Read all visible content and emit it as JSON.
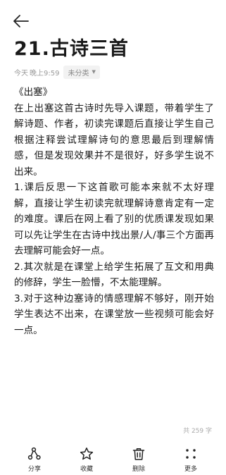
{
  "header": {
    "back_icon": "arrow-left-icon"
  },
  "note": {
    "title": "21.古诗三首",
    "date": "今天",
    "time": "晚上9:59",
    "category": "未分类",
    "category_icon": "triangle-down-icon",
    "paragraphs": [
      "《出塞》",
      "在上出塞这首古诗时先导入课题，带着学生了解诗题、作者，初读完课题后直接让学生自己根据注释尝试理解诗句的意思最后到理解情感，但是发现效果并不是很好，好多学生说不出来。",
      "1.课后反思一下这首歌可能本来就不太好理解，直接让学生初读完就理解诗意肯定有一定的难度。课后在网上看了别的优质课发现如果可以先让学生在古诗中找出景/人/事三个方面再去理解可能会好一点。",
      "2.其次就是在课堂上给学生拓展了互文和用典的修辞，学生一脸懵，不太能理解。",
      "3.对于这种边塞诗的情感理解不够好，刚开始学生表达不出来，在课堂放一些视频可能会好一点。"
    ],
    "char_count": "共 259 字"
  },
  "toolbar": {
    "items": [
      {
        "label": "分享",
        "icon": "share-icon"
      },
      {
        "label": "收藏",
        "icon": "star-icon"
      },
      {
        "label": "删除",
        "icon": "trash-icon"
      },
      {
        "label": "更多",
        "icon": "more-icon"
      }
    ]
  },
  "colors": {
    "text": "#1a1a1a",
    "meta": "#9a9a9a",
    "chip_bg": "#f2f2f2",
    "background": "#ffffff"
  }
}
